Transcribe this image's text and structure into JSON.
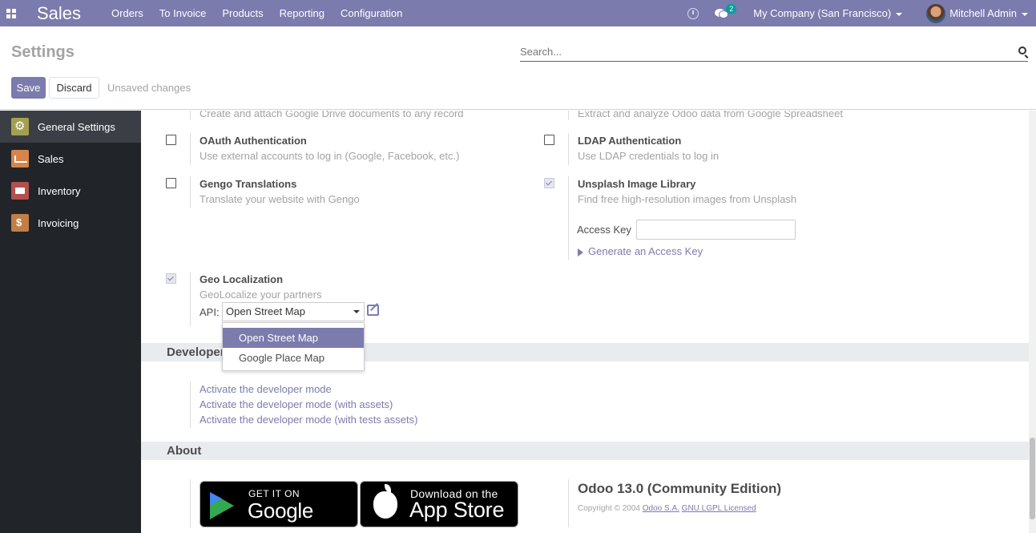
{
  "navbar": {
    "app_name": "Sales",
    "menu": [
      "Orders",
      "To Invoice",
      "Products",
      "Reporting",
      "Configuration"
    ],
    "chat_count": "2",
    "company": "My Company (San Francisco)",
    "user": "Mitchell Admin",
    "accent_color": "#7c7bad"
  },
  "control": {
    "title": "Settings",
    "search_placeholder": "Search...",
    "save_label": "Save",
    "discard_label": "Discard",
    "status": "Unsaved changes"
  },
  "sidebar": {
    "items": [
      {
        "label": "General Settings",
        "icon": "settings-app-icon",
        "active": true
      },
      {
        "label": "Sales",
        "icon": "sales-app-icon"
      },
      {
        "label": "Inventory",
        "icon": "inventory-app-icon"
      },
      {
        "label": "Invoicing",
        "icon": "invoicing-app-icon"
      }
    ]
  },
  "settings": {
    "google_drive_desc": "Create and attach Google Drive documents to any record",
    "google_sheet_desc": "Extract and analyze Odoo data from Google Spreadsheet",
    "oauth": {
      "title": "OAuth Authentication",
      "desc": "Use external accounts to log in (Google, Facebook, etc.)",
      "checked": false
    },
    "ldap": {
      "title": "LDAP Authentication",
      "desc": "Use LDAP credentials to log in",
      "checked": false
    },
    "gengo": {
      "title": "Gengo Translations",
      "desc": "Translate your website with Gengo",
      "checked": false
    },
    "unsplash": {
      "title": "Unsplash Image Library",
      "desc": "Find free high-resolution images from Unsplash",
      "checked": true,
      "access_key_label": "Access Key",
      "access_key_value": "",
      "generate_link": "Generate an Access Key"
    },
    "geo": {
      "title": "Geo Localization",
      "desc": "GeoLocalize your partners",
      "checked": true,
      "api_label": "API:",
      "api_value": "Open Street Map",
      "options": [
        "Open Street Map",
        "Google Place Map"
      ]
    }
  },
  "developer": {
    "heading": "Developer",
    "links": [
      "Activate the developer mode",
      "Activate the developer mode (with assets)",
      "Activate the developer mode (with tests assets)"
    ]
  },
  "about": {
    "heading": "About",
    "google_play_top": "GET IT ON",
    "google_play_main": "Google Play",
    "app_store_top": "Download on the",
    "app_store_main": "App Store",
    "version": "Odoo 13.0 (Community Edition)",
    "copyright_prefix": "Copyright © 2004",
    "company_link": "Odoo S.A.",
    "license_link": "GNU LGPL Licensed"
  }
}
